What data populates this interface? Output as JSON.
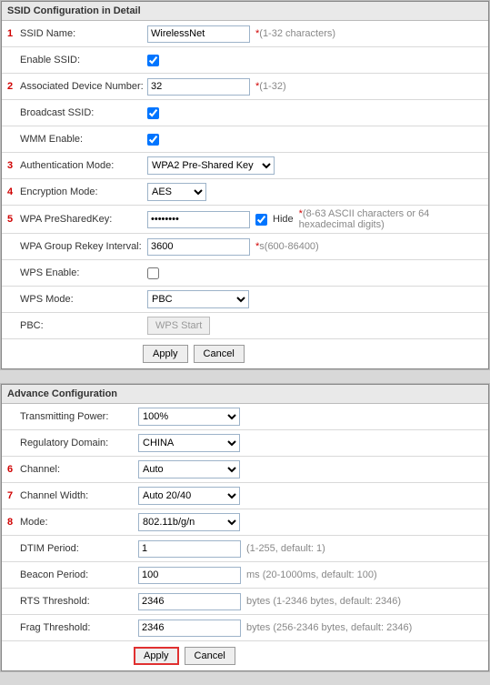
{
  "ssid_panel": {
    "title": "SSID Configuration in Detail",
    "ssid_name": {
      "lbl": "SSID Name:",
      "val": "WirelessNet",
      "hint": "(1-32 characters)"
    },
    "enable_ssid": {
      "lbl": "Enable SSID:"
    },
    "assoc": {
      "lbl": "Associated Device Number:",
      "val": "32",
      "hint": "(1-32)"
    },
    "broadcast": {
      "lbl": "Broadcast SSID:"
    },
    "wmm": {
      "lbl": "WMM Enable:"
    },
    "auth": {
      "lbl": "Authentication Mode:",
      "val": "WPA2 Pre-Shared Key"
    },
    "enc": {
      "lbl": "Encryption Mode:",
      "val": "AES"
    },
    "psk": {
      "lbl": "WPA PreSharedKey:",
      "val": "••••••••",
      "hide": "Hide",
      "hint": "(8-63 ASCII characters or 64 hexadecimal digits)"
    },
    "rekey": {
      "lbl": "WPA Group Rekey Interval:",
      "val": "3600",
      "hint": "s(600-86400)"
    },
    "wps_en": {
      "lbl": "WPS Enable:"
    },
    "wps_mode": {
      "lbl": "WPS Mode:",
      "val": "PBC"
    },
    "pbc": {
      "lbl": "PBC:",
      "btn": "WPS Start"
    }
  },
  "adv_panel": {
    "title": "Advance Configuration",
    "power": {
      "lbl": "Transmitting Power:",
      "val": "100%"
    },
    "reg": {
      "lbl": "Regulatory Domain:",
      "val": "CHINA"
    },
    "chan": {
      "lbl": "Channel:",
      "val": "Auto"
    },
    "chw": {
      "lbl": "Channel Width:",
      "val": "Auto 20/40"
    },
    "mode": {
      "lbl": "Mode:",
      "val": "802.11b/g/n"
    },
    "dtim": {
      "lbl": "DTIM Period:",
      "val": "1",
      "hint": "(1-255, default: 1)"
    },
    "beacon": {
      "lbl": "Beacon Period:",
      "val": "100",
      "hint": "ms (20-1000ms, default: 100)"
    },
    "rts": {
      "lbl": "RTS Threshold:",
      "val": "2346",
      "hint": "bytes (1-2346 bytes, default: 2346)"
    },
    "frag": {
      "lbl": "Frag Threshold:",
      "val": "2346",
      "hint": "bytes (256-2346 bytes, default: 2346)"
    }
  },
  "btn": {
    "apply": "Apply",
    "cancel": "Cancel"
  },
  "marks": {
    "1": "1",
    "2": "2",
    "3": "3",
    "4": "4",
    "5": "5",
    "6": "6",
    "7": "7",
    "8": "8",
    "star": "*"
  }
}
